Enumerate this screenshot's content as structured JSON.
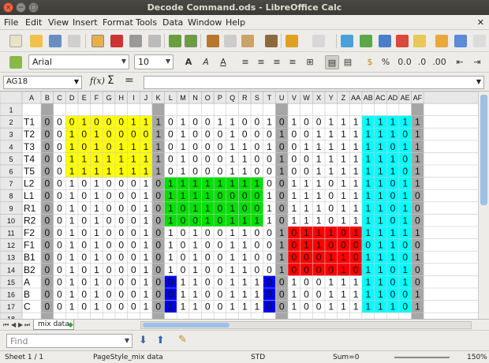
{
  "window": {
    "title": "Decode Command.ods - LibreOffice Calc"
  },
  "menu": [
    "File",
    "Edit",
    "View",
    "Insert",
    "Format",
    "Tools",
    "Data",
    "Window",
    "Help"
  ],
  "menu_close": "✕",
  "toolbar2": {
    "font": "Arial",
    "size": "10"
  },
  "formula": {
    "namebox": "AG18",
    "fx": "f(x)",
    "sigma": "Σ",
    "equals": "=",
    "content": ""
  },
  "columns": [
    "A",
    "B",
    "C",
    "D",
    "E",
    "F",
    "G",
    "H",
    "I",
    "J",
    "K",
    "L",
    "M",
    "N",
    "O",
    "P",
    "Q",
    "R",
    "S",
    "T",
    "U",
    "V",
    "W",
    "X",
    "Y",
    "Z",
    "AA",
    "AB",
    "AC",
    "AD",
    "AE",
    "AF"
  ],
  "rows": [
    {
      "n": "1",
      "a": "",
      "bits": ""
    },
    {
      "n": "2",
      "a": "T1",
      "bits": "000100011101001100101001111111101"
    },
    {
      "n": "3",
      "a": "T2",
      "bits": "001010000101000100010011111110101"
    },
    {
      "n": "4",
      "a": "T3",
      "bits": "001010111101000110100111111101101"
    },
    {
      "n": "5",
      "a": "T4",
      "bits": "001111111101000110010011111110101"
    },
    {
      "n": "6",
      "a": "T5",
      "bits": "001111111101000110010011111110101"
    },
    {
      "n": "7",
      "a": "L2",
      "bits": "001010001011111111001110111101101"
    },
    {
      "n": "8",
      "a": "L1",
      "bits": "001010001011110000101110111101011"
    },
    {
      "n": "9",
      "a": "R1",
      "bits": "001010001010110100101110111101001"
    },
    {
      "n": "10",
      "a": "R2",
      "bits": "001010001010010111101110111101001"
    },
    {
      "n": "11",
      "a": "F2",
      "bits": "001010001010100110010111011111101"
    },
    {
      "n": "12",
      "a": "F1",
      "bits": "001010001010100110010110000110011"
    },
    {
      "n": "13",
      "a": "B1",
      "bits": "001010001010100110010001101110101"
    },
    {
      "n": "14",
      "a": "B2",
      "bits": "001010001010100110010000101101011"
    },
    {
      "n": "15",
      "a": "A",
      "bits": "001010001001100111001001111101011"
    },
    {
      "n": "16",
      "a": "B",
      "bits": "001010001001100111001001111100101"
    },
    {
      "n": "17",
      "a": "C",
      "bits": "001010001011100111001001111110101"
    },
    {
      "n": "18",
      "a": "",
      "bits": ""
    }
  ],
  "sheet_tab": "mix data",
  "find": {
    "placeholder": "Find"
  },
  "status": {
    "sheet": "Sheet 1 / 1",
    "style": "PageStyle_mix data",
    "mode": "STD",
    "sum": "Sum=0",
    "zoom": "150%"
  },
  "colors": {
    "yellow": "#ffff00",
    "green": "#00e000",
    "red": "#ff0000",
    "blue": "#0000ee",
    "cyan": "#00ffff",
    "gray": "#a6a6a6",
    "header": "#e8e8e8"
  }
}
